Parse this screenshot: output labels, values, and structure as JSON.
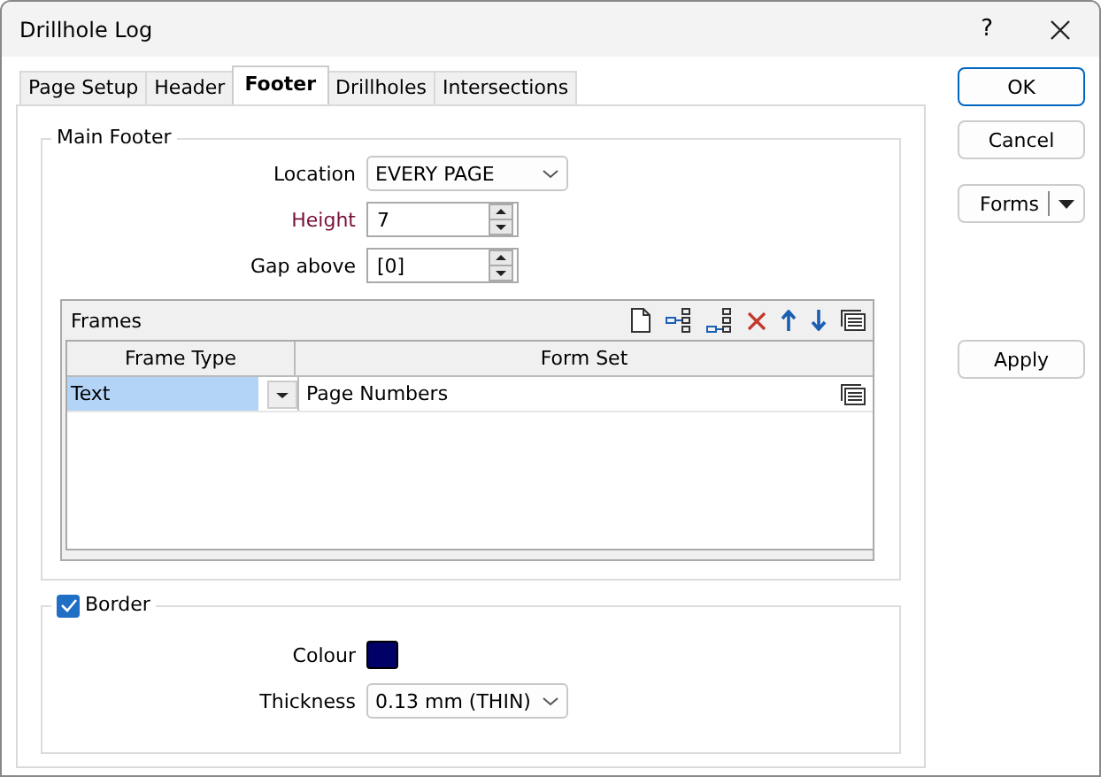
{
  "window": {
    "title": "Drillhole Log",
    "help": "?"
  },
  "tabs": [
    {
      "label": "Page Setup",
      "selected": false
    },
    {
      "label": "Header",
      "selected": false
    },
    {
      "label": "Footer",
      "selected": true
    },
    {
      "label": "Drillholes",
      "selected": false
    },
    {
      "label": "Intersections",
      "selected": false
    }
  ],
  "main_footer": {
    "title": "Main Footer",
    "fields": [
      {
        "kind": "dropdown",
        "label": "Location",
        "value": "EVERY PAGE",
        "highlighted": false
      },
      {
        "kind": "spin",
        "label": "Height",
        "value": "7",
        "highlighted": true
      },
      {
        "kind": "spin",
        "label": "Gap above",
        "value": "[0]",
        "highlighted": false
      }
    ]
  },
  "frames": {
    "title": "Frames",
    "columns": [
      "Frame Type",
      "Form Set"
    ],
    "rows": [
      {
        "frame_type": "Text",
        "form_set": "Page Numbers",
        "selected": true
      }
    ]
  },
  "border": {
    "label": "Border",
    "checked": true,
    "fields": [
      {
        "kind": "color",
        "label": "Colour",
        "color": "#000066"
      },
      {
        "kind": "dropdown",
        "label": "Thickness",
        "value": "0.13 mm (THIN)"
      }
    ]
  },
  "buttons": [
    {
      "label": "OK",
      "kind": "default"
    },
    {
      "label": "Cancel",
      "kind": "plain"
    },
    {
      "label": "Forms",
      "kind": "split"
    },
    {
      "label": "Apply",
      "kind": "plain"
    }
  ]
}
